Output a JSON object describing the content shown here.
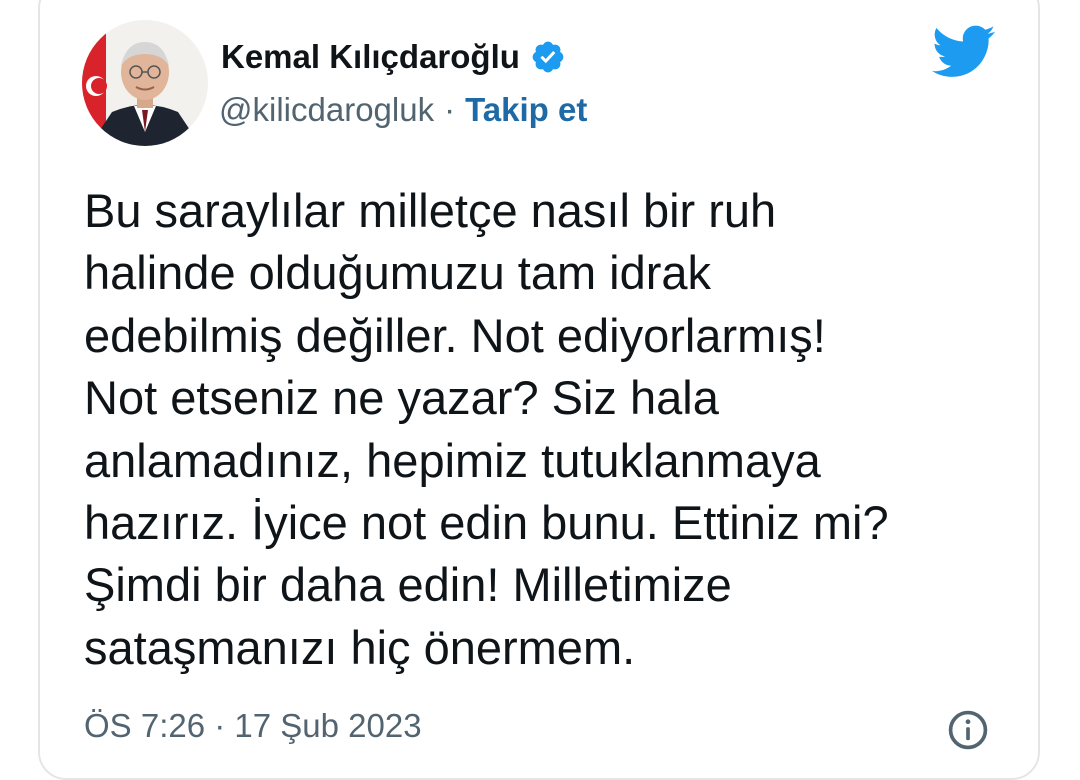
{
  "tweet": {
    "author": {
      "display_name": "Kemal Kılıçdaroğlu",
      "handle": "@kilicdarogluk",
      "verified": true,
      "verified_icon": "verified-badge-icon"
    },
    "separator": "·",
    "follow_label": "Takip et",
    "text_lines": [
      "Bu saraylılar milletçe nasıl bir ruh",
      "halinde olduğumuzu tam idrak",
      "edebilmiş değiller. Not ediyorlarmış!",
      "Not etseniz ne yazar? Siz hala",
      "anlamadınız, hepimiz tutuklanmaya",
      "hazırız. İyice not edin bunu. Ettiniz mi?",
      "Şimdi bir daha edin! Milletimize",
      "sataşmanızı hiç önermem."
    ],
    "timestamp": "ÖS 7:26 · 17 Şub 2023"
  },
  "icons": {
    "logo": "twitter-bird-icon",
    "info": "info-icon"
  },
  "colors": {
    "text": "#0f1419",
    "secondary": "#536471",
    "link": "#1d6aa6",
    "brand": "#1d9bf0"
  }
}
